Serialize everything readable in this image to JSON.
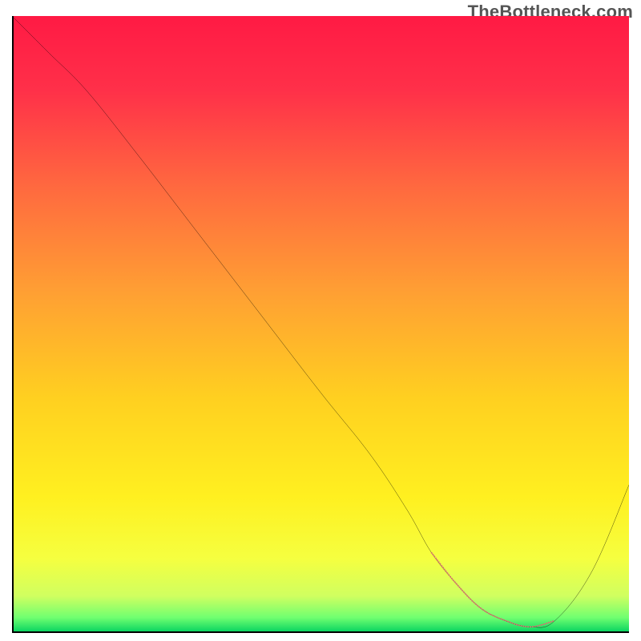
{
  "watermark": "TheBottleneck.com",
  "chart_data": {
    "type": "line",
    "title": "",
    "xlabel": "",
    "ylabel": "",
    "xlim": [
      0,
      100
    ],
    "ylim": [
      0,
      100
    ],
    "series": [
      {
        "name": "bottleneck-curve",
        "x": [
          0,
          6,
          12,
          20,
          30,
          40,
          50,
          58,
          64,
          68,
          72,
          76,
          80,
          84,
          88,
          94,
          100
        ],
        "values": [
          100,
          94,
          88,
          78,
          65,
          52,
          39,
          29,
          20,
          13,
          8,
          4,
          2,
          1,
          2,
          10,
          24
        ]
      },
      {
        "name": "highlight-segment",
        "x": [
          68,
          72,
          76,
          80,
          84,
          88
        ],
        "values": [
          13,
          8,
          4,
          2,
          1,
          2
        ]
      }
    ],
    "gradient_stops": [
      {
        "offset": 0.0,
        "color": "#ff1a44"
      },
      {
        "offset": 0.12,
        "color": "#ff3049"
      },
      {
        "offset": 0.28,
        "color": "#ff6a3f"
      },
      {
        "offset": 0.45,
        "color": "#ffa033"
      },
      {
        "offset": 0.62,
        "color": "#ffd020"
      },
      {
        "offset": 0.78,
        "color": "#fff020"
      },
      {
        "offset": 0.88,
        "color": "#f5ff40"
      },
      {
        "offset": 0.94,
        "color": "#d0ff60"
      },
      {
        "offset": 0.975,
        "color": "#70ff70"
      },
      {
        "offset": 1.0,
        "color": "#00d060"
      }
    ]
  }
}
